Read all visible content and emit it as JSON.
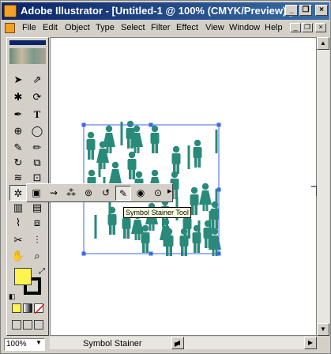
{
  "window": {
    "title": "Adobe Illustrator - [Untitled-1 @ 100% (CMYK/Preview) ]",
    "minimize_label": "_",
    "restore_label": "❐",
    "close_label": "×"
  },
  "menu": {
    "items": [
      "File",
      "Edit",
      "Object",
      "Type",
      "Select",
      "Filter",
      "Effect",
      "View",
      "Window",
      "Help"
    ]
  },
  "document_controls": {
    "minimize_label": "_",
    "restore_label": "❐",
    "close_label": "×"
  },
  "status": {
    "zoom": "100%",
    "current_tool": "Symbol Stainer"
  },
  "tooltip": "Symbol Stainer Tool",
  "colors": {
    "fill": "#fff44f",
    "stroke": "#000000",
    "symbol": "#2a8a7a",
    "selection": "#3a6adf"
  },
  "tools": [
    {
      "name": "selection-tool",
      "icon": "arrow-icon"
    },
    {
      "name": "direct-selection-tool",
      "icon": "hollow-arrow-icon"
    },
    {
      "name": "magic-wand-tool",
      "icon": "wand-icon"
    },
    {
      "name": "lasso-tool",
      "icon": "lasso-icon"
    },
    {
      "name": "pen-tool",
      "icon": "pen-icon"
    },
    {
      "name": "type-tool",
      "icon": "type-icon"
    },
    {
      "name": "line-segment-tool",
      "icon": "spiral-icon"
    },
    {
      "name": "ellipse-tool",
      "icon": "ellipse-icon"
    },
    {
      "name": "paintbrush-tool",
      "icon": "brush-icon"
    },
    {
      "name": "pencil-tool",
      "icon": "pencil-icon"
    },
    {
      "name": "rotate-tool",
      "icon": "rotate-icon"
    },
    {
      "name": "scale-tool",
      "icon": "scale-icon"
    },
    {
      "name": "warp-tool",
      "icon": "warp-icon"
    },
    {
      "name": "free-transform-tool",
      "icon": "free-transform-icon"
    },
    {
      "name": "symbol-sprayer-tool",
      "icon": "symbol-sprayer-icon"
    },
    {
      "name": "graph-tool",
      "icon": "graph-icon"
    },
    {
      "name": "mesh-tool",
      "icon": "mesh-icon"
    },
    {
      "name": "gradient-tool",
      "icon": "gradient-icon"
    },
    {
      "name": "eyedropper-tool",
      "icon": "eyedropper-icon"
    },
    {
      "name": "blend-tool",
      "icon": "blend-icon"
    },
    {
      "name": "slice-tool",
      "icon": "slice-icon"
    },
    {
      "name": "scissors-tool",
      "icon": "scissors-icon"
    },
    {
      "name": "hand-tool",
      "icon": "hand-icon"
    },
    {
      "name": "zoom-tool",
      "icon": "zoom-icon"
    }
  ],
  "symbol_flyout": [
    {
      "name": "symbol-sprayer",
      "icon": "sprayer-icon"
    },
    {
      "name": "symbol-shifter",
      "icon": "shifter-icon"
    },
    {
      "name": "symbol-scruncher",
      "icon": "scruncher-icon"
    },
    {
      "name": "symbol-sizer",
      "icon": "sizer-icon"
    },
    {
      "name": "symbol-spinner",
      "icon": "spinner-icon"
    },
    {
      "name": "symbol-stainer",
      "icon": "stainer-icon"
    },
    {
      "name": "symbol-screener",
      "icon": "screener-icon"
    },
    {
      "name": "symbol-styler",
      "icon": "styler-icon"
    }
  ]
}
